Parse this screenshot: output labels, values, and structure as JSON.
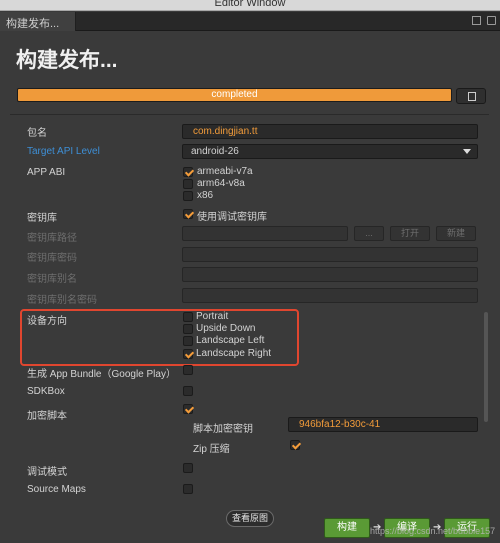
{
  "window": {
    "title": "Editor Window",
    "tab_label": "构建发布..."
  },
  "header": {
    "title": "构建发布...",
    "progress_text": "completed",
    "progress": 1.0
  },
  "form": {
    "package_label": "包名",
    "package_value": "com.dingjian.tt",
    "target_api_label": "Target API Level",
    "target_api_value": "android-26",
    "app_abi_label": "APP ABI",
    "abi_options": [
      {
        "label": "armeabi-v7a",
        "checked": true
      },
      {
        "label": "arm64-v8a",
        "checked": false
      },
      {
        "label": "x86",
        "checked": false
      }
    ],
    "keystore_label": "密钥库",
    "keystore_debug_label": "使用调试密钥库",
    "keystore_debug_checked": true,
    "keystore_path_label": "密钥库路径",
    "browse_label": "...",
    "open_label": "打开",
    "new_label": "新建",
    "keystore_password_label": "密钥库密码",
    "keystore_alias_label": "密钥库别名",
    "keystore_alias_password_label": "密钥库别名密码",
    "orientation_label": "设备方向",
    "orientation_options": [
      {
        "label": "Portrait",
        "checked": false
      },
      {
        "label": "Upside Down",
        "checked": false
      },
      {
        "label": "Landscape Left",
        "checked": false
      },
      {
        "label": "Landscape Right",
        "checked": true
      }
    ],
    "app_bundle_label": "生成 App Bundle（Google Play）",
    "sdkbox_label": "SDKBox",
    "encrypt_label": "加密脚本",
    "encrypt_key_label": "脚本加密密钥",
    "encrypt_key_value": "946bfa12-b30c-41",
    "zip_label": "Zip 压缩",
    "debug_label": "调试模式",
    "source_maps_label": "Source Maps"
  },
  "footer": {
    "view_button": "查看原图",
    "build_button": "构建",
    "compile_button": "编译",
    "run_button": "运行",
    "watermark": "https://blog.csdn.net/bubble157"
  },
  "colors": {
    "accent": "#f39c3a",
    "highlight": "#e0462f",
    "button_green": "#5a9a35",
    "link": "#3e8fd6"
  }
}
